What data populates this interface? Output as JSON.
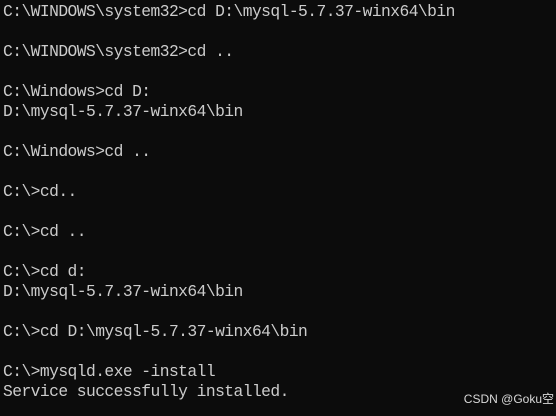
{
  "terminal": {
    "background": "#0c0c0c",
    "text_color": "#cccccc",
    "lines": [
      "C:\\WINDOWS\\system32>cd D:\\mysql-5.7.37-winx64\\bin",
      "",
      "C:\\WINDOWS\\system32>cd ..",
      "",
      "C:\\Windows>cd D:",
      "D:\\mysql-5.7.37-winx64\\bin",
      "",
      "C:\\Windows>cd ..",
      "",
      "C:\\>cd..",
      "",
      "C:\\>cd ..",
      "",
      "C:\\>cd d:",
      "D:\\mysql-5.7.37-winx64\\bin",
      "",
      "C:\\>cd D:\\mysql-5.7.37-winx64\\bin",
      "",
      "C:\\>mysqld.exe -install",
      "Service successfully installed."
    ]
  },
  "watermark": "CSDN @Goku空"
}
